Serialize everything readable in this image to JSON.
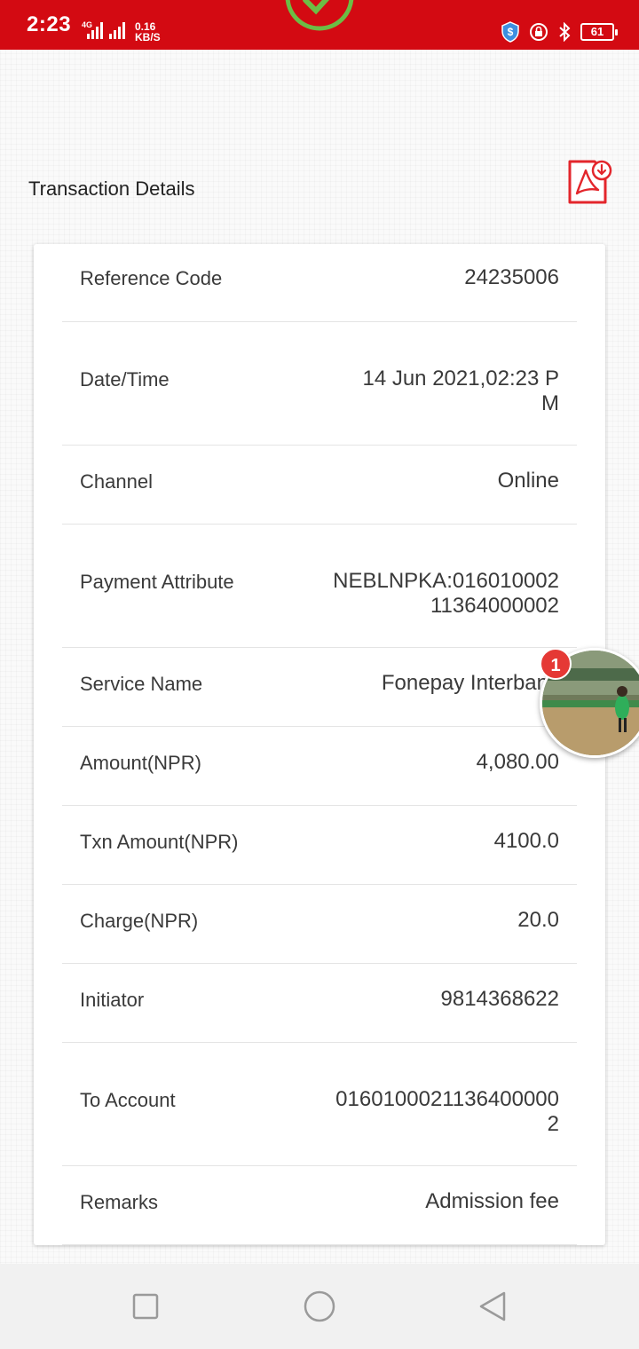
{
  "status_bar": {
    "time": "2:23",
    "network_label": "4G",
    "speed_value": "0.16",
    "speed_unit": "KB/S",
    "battery": "61",
    "icons": [
      "signal-icon",
      "shield-icon",
      "vpn-lock-icon",
      "bluetooth-icon",
      "battery-icon"
    ]
  },
  "header": {
    "section_title": "Transaction Details",
    "pdf_icon": "pdf-download-icon"
  },
  "details": [
    {
      "label": "Reference Code",
      "value": "24235006"
    },
    {
      "label": "Date/Time",
      "value": "14 Jun 2021,02:23 PM"
    },
    {
      "label": "Channel",
      "value": "Online"
    },
    {
      "label": "Payment Attribute",
      "value": "NEBLNPKA:01601000211364000002"
    },
    {
      "label": "Service Name",
      "value": "Fonepay Interbank"
    },
    {
      "label": "Amount(NPR)",
      "value": "4,080.00"
    },
    {
      "label": "Txn Amount(NPR)",
      "value": "4100.0"
    },
    {
      "label": "Charge(NPR)",
      "value": "20.0"
    },
    {
      "label": "Initiator",
      "value": "9814368622"
    },
    {
      "label": "To Account",
      "value": "01601000211364000002"
    },
    {
      "label": "Remarks",
      "value": "Admission fee"
    }
  ],
  "chat_bubble": {
    "badge_count": "1"
  },
  "nav": {
    "icons": [
      "recents-square-icon",
      "home-circle-icon",
      "back-triangle-icon"
    ]
  },
  "colors": {
    "status_bar": "#d30a12",
    "accent_red": "#e3262c",
    "success_green": "#6cbd45"
  }
}
